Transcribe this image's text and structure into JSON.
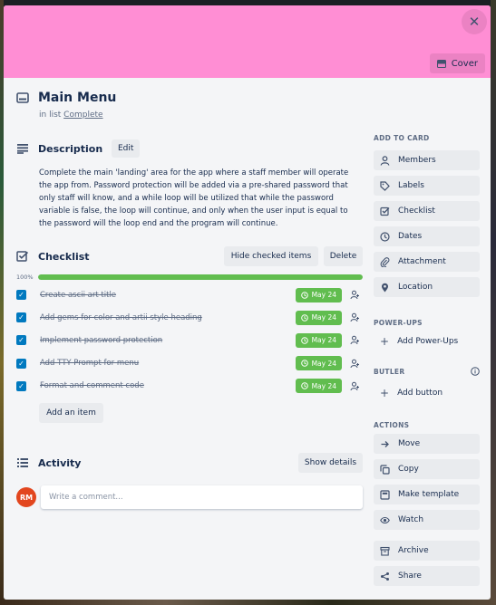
{
  "colors": {
    "cover": "#ff8ed4",
    "checkbox": "#0079bf",
    "due": "#61bd4f",
    "avatar": "#e2461e"
  },
  "cover": {
    "button_label": "Cover",
    "close_glyph": "✕"
  },
  "card": {
    "title": "Main Menu",
    "in_list_prefix": "in list",
    "list_name": "Complete"
  },
  "description": {
    "title": "Description",
    "edit_label": "Edit",
    "text": "Complete the main 'landing' area for the app where a staff member will operate the app from. Password protection will be added via a pre-shared password that only staff will know, and a while loop will be utilized that while the password variable is false, the loop will continue, and only when the user input is equal to the password will the loop end and the program will continue."
  },
  "checklist": {
    "title": "Checklist",
    "hide_label": "Hide checked items",
    "delete_label": "Delete",
    "progress_label": "100%",
    "progress": 100,
    "items": [
      {
        "text": "Create ascii art title",
        "due": "May 24"
      },
      {
        "text": "Add gems for color and artii style heading",
        "due": "May 24"
      },
      {
        "text": "Implement password protection",
        "due": "May 24"
      },
      {
        "text": "Add TTY Prompt for menu",
        "due": "May 24"
      },
      {
        "text": "Format and comment code",
        "due": "May 24"
      }
    ],
    "add_label": "Add an item"
  },
  "activity": {
    "title": "Activity",
    "show_details_label": "Show details",
    "avatar_initials": "RM",
    "comment_placeholder": "Write a comment..."
  },
  "sidebar": {
    "add_to_card": {
      "label": "ADD TO CARD",
      "buttons": [
        {
          "label": "Members",
          "icon": "person-icon"
        },
        {
          "label": "Labels",
          "icon": "tag-icon"
        },
        {
          "label": "Checklist",
          "icon": "checklist-icon"
        },
        {
          "label": "Dates",
          "icon": "clock-icon"
        },
        {
          "label": "Attachment",
          "icon": "paperclip-icon"
        },
        {
          "label": "Location",
          "icon": "pin-icon"
        }
      ]
    },
    "power_ups": {
      "label": "POWER-UPS",
      "add_label": "Add Power-Ups"
    },
    "butler": {
      "label": "BUTLER",
      "add_label": "Add button"
    },
    "actions": {
      "label": "ACTIONS",
      "buttons": [
        {
          "label": "Move",
          "icon": "arrow-right-icon"
        },
        {
          "label": "Copy",
          "icon": "copy-icon"
        },
        {
          "label": "Make template",
          "icon": "template-icon"
        },
        {
          "label": "Watch",
          "icon": "eye-icon"
        },
        {
          "label": "Archive",
          "icon": "archive-icon"
        },
        {
          "label": "Share",
          "icon": "share-icon"
        }
      ]
    }
  }
}
